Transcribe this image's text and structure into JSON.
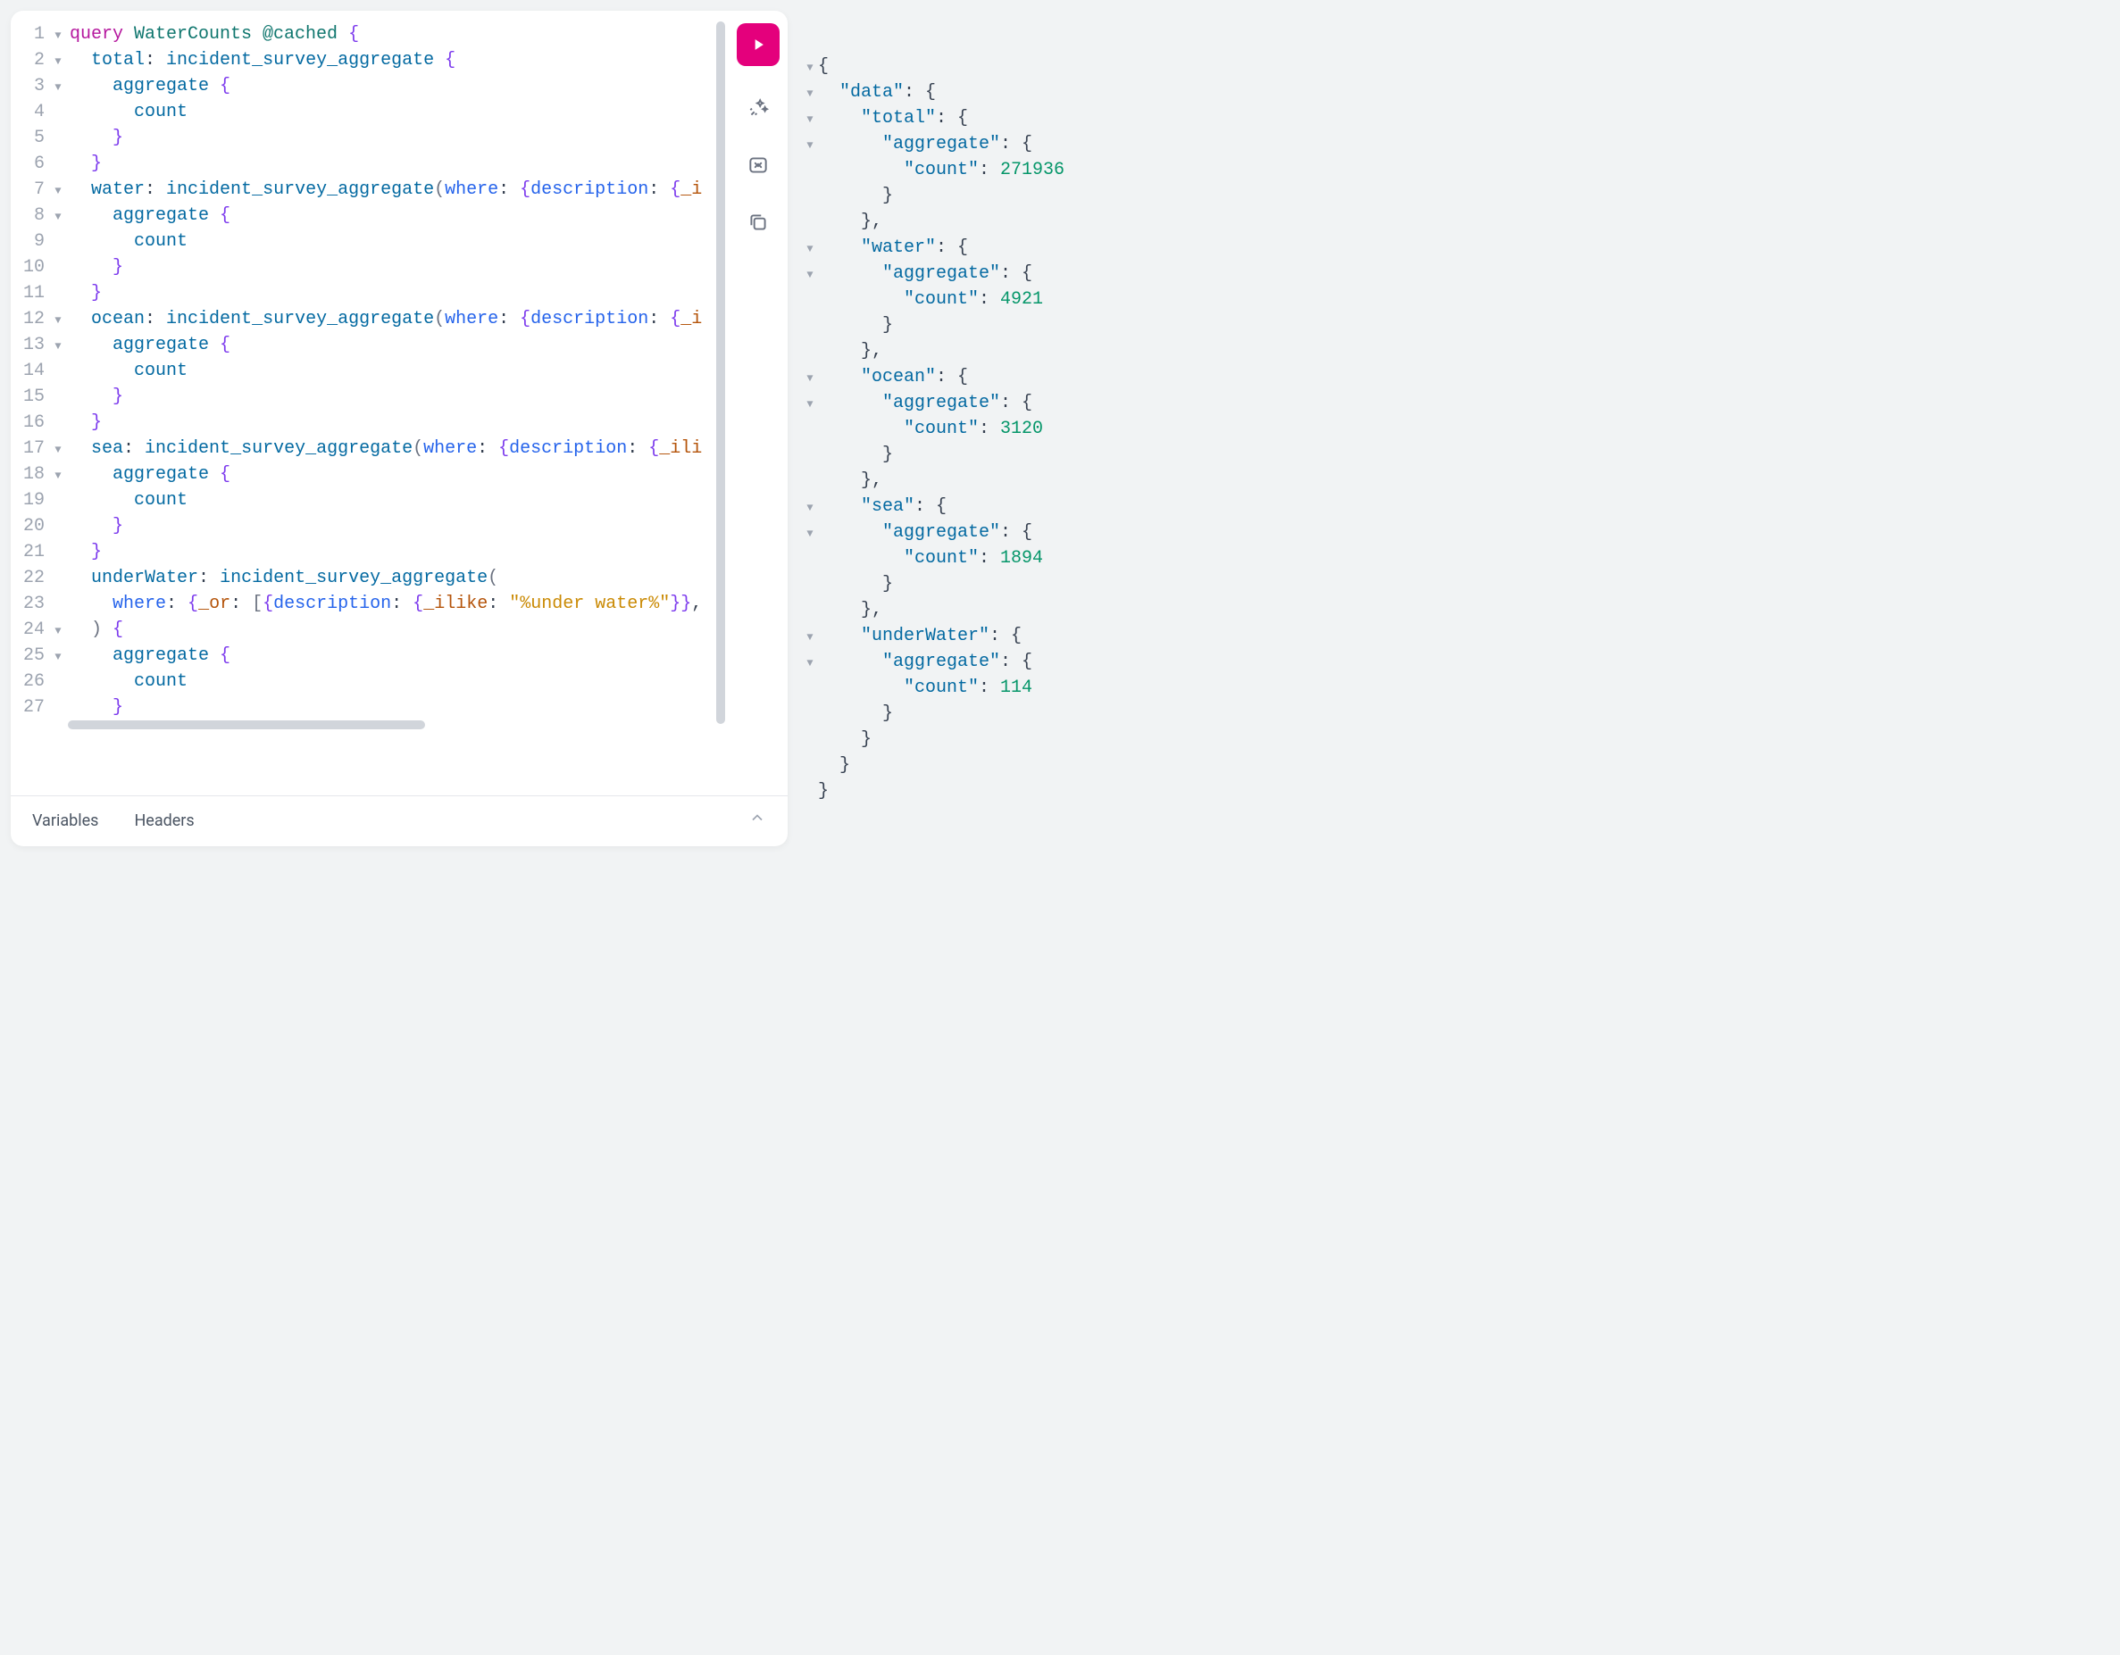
{
  "editor": {
    "lines": [
      {
        "n": 1,
        "fold": true,
        "tokens": [
          [
            "kw",
            "query "
          ],
          [
            "name",
            "WaterCounts "
          ],
          [
            "name",
            "@cached "
          ],
          [
            "brace",
            "{"
          ]
        ]
      },
      {
        "n": 2,
        "fold": true,
        "indent": 1,
        "tokens": [
          [
            "field",
            "total"
          ],
          [
            "plain",
            ": "
          ],
          [
            "field",
            "incident_survey_aggregate "
          ],
          [
            "brace",
            "{"
          ]
        ]
      },
      {
        "n": 3,
        "fold": true,
        "indent": 2,
        "tokens": [
          [
            "field",
            "aggregate "
          ],
          [
            "brace",
            "{"
          ]
        ]
      },
      {
        "n": 4,
        "fold": false,
        "indent": 3,
        "tokens": [
          [
            "field",
            "count"
          ]
        ]
      },
      {
        "n": 5,
        "fold": false,
        "indent": 2,
        "tokens": [
          [
            "brace",
            "}"
          ]
        ]
      },
      {
        "n": 6,
        "fold": false,
        "indent": 1,
        "tokens": [
          [
            "brace",
            "}"
          ]
        ]
      },
      {
        "n": 7,
        "fold": true,
        "indent": 1,
        "tokens": [
          [
            "field",
            "water"
          ],
          [
            "plain",
            ": "
          ],
          [
            "field",
            "incident_survey_aggregate"
          ],
          [
            "paren",
            "("
          ],
          [
            "arg",
            "where"
          ],
          [
            "plain",
            ": "
          ],
          [
            "brace",
            "{"
          ],
          [
            "arg",
            "description"
          ],
          [
            "plain",
            ": "
          ],
          [
            "brace",
            "{"
          ],
          [
            "und",
            "_i"
          ]
        ]
      },
      {
        "n": 8,
        "fold": true,
        "indent": 2,
        "tokens": [
          [
            "field",
            "aggregate "
          ],
          [
            "brace",
            "{"
          ]
        ]
      },
      {
        "n": 9,
        "fold": false,
        "indent": 3,
        "tokens": [
          [
            "field",
            "count"
          ]
        ]
      },
      {
        "n": 10,
        "fold": false,
        "indent": 2,
        "tokens": [
          [
            "brace",
            "}"
          ]
        ]
      },
      {
        "n": 11,
        "fold": false,
        "indent": 1,
        "tokens": [
          [
            "brace",
            "}"
          ]
        ]
      },
      {
        "n": 12,
        "fold": true,
        "indent": 1,
        "tokens": [
          [
            "field",
            "ocean"
          ],
          [
            "plain",
            ": "
          ],
          [
            "field",
            "incident_survey_aggregate"
          ],
          [
            "paren",
            "("
          ],
          [
            "arg",
            "where"
          ],
          [
            "plain",
            ": "
          ],
          [
            "brace",
            "{"
          ],
          [
            "arg",
            "description"
          ],
          [
            "plain",
            ": "
          ],
          [
            "brace",
            "{"
          ],
          [
            "und",
            "_i"
          ]
        ]
      },
      {
        "n": 13,
        "fold": true,
        "indent": 2,
        "tokens": [
          [
            "field",
            "aggregate "
          ],
          [
            "brace",
            "{"
          ]
        ]
      },
      {
        "n": 14,
        "fold": false,
        "indent": 3,
        "tokens": [
          [
            "field",
            "count"
          ]
        ]
      },
      {
        "n": 15,
        "fold": false,
        "indent": 2,
        "tokens": [
          [
            "brace",
            "}"
          ]
        ]
      },
      {
        "n": 16,
        "fold": false,
        "indent": 1,
        "tokens": [
          [
            "brace",
            "}"
          ]
        ]
      },
      {
        "n": 17,
        "fold": true,
        "indent": 1,
        "tokens": [
          [
            "field",
            "sea"
          ],
          [
            "plain",
            ": "
          ],
          [
            "field",
            "incident_survey_aggregate"
          ],
          [
            "paren",
            "("
          ],
          [
            "arg",
            "where"
          ],
          [
            "plain",
            ": "
          ],
          [
            "brace",
            "{"
          ],
          [
            "arg",
            "description"
          ],
          [
            "plain",
            ": "
          ],
          [
            "brace",
            "{"
          ],
          [
            "und",
            "_ili"
          ]
        ]
      },
      {
        "n": 18,
        "fold": true,
        "indent": 2,
        "tokens": [
          [
            "field",
            "aggregate "
          ],
          [
            "brace",
            "{"
          ]
        ]
      },
      {
        "n": 19,
        "fold": false,
        "indent": 3,
        "tokens": [
          [
            "field",
            "count"
          ]
        ]
      },
      {
        "n": 20,
        "fold": false,
        "indent": 2,
        "tokens": [
          [
            "brace",
            "}"
          ]
        ]
      },
      {
        "n": 21,
        "fold": false,
        "indent": 1,
        "tokens": [
          [
            "brace",
            "}"
          ]
        ]
      },
      {
        "n": 22,
        "fold": false,
        "indent": 1,
        "tokens": [
          [
            "field",
            "underWater"
          ],
          [
            "plain",
            ": "
          ],
          [
            "field",
            "incident_survey_aggregate"
          ],
          [
            "paren",
            "("
          ]
        ]
      },
      {
        "n": 23,
        "fold": false,
        "indent": 2,
        "tokens": [
          [
            "arg",
            "where"
          ],
          [
            "plain",
            ": "
          ],
          [
            "brace",
            "{"
          ],
          [
            "und",
            "_or"
          ],
          [
            "plain",
            ": "
          ],
          [
            "paren",
            "["
          ],
          [
            "brace",
            "{"
          ],
          [
            "arg",
            "description"
          ],
          [
            "plain",
            ": "
          ],
          [
            "brace",
            "{"
          ],
          [
            "und",
            "_ilike"
          ],
          [
            "plain",
            ": "
          ],
          [
            "str",
            "\"%under water%\""
          ],
          [
            "brace",
            "}}"
          ],
          [
            "plain",
            ","
          ]
        ]
      },
      {
        "n": 24,
        "fold": true,
        "indent": 1,
        "tokens": [
          [
            "paren",
            ") "
          ],
          [
            "brace",
            "{"
          ]
        ]
      },
      {
        "n": 25,
        "fold": true,
        "indent": 2,
        "tokens": [
          [
            "field",
            "aggregate "
          ],
          [
            "brace",
            "{"
          ]
        ]
      },
      {
        "n": 26,
        "fold": false,
        "indent": 3,
        "tokens": [
          [
            "field",
            "count"
          ]
        ]
      },
      {
        "n": 27,
        "fold": false,
        "indent": 2,
        "tokens": [
          [
            "brace",
            "}"
          ]
        ]
      }
    ]
  },
  "result": {
    "lines": [
      {
        "fold": true,
        "indent": 0,
        "tokens": [
          [
            "jp",
            "{"
          ]
        ]
      },
      {
        "fold": true,
        "indent": 1,
        "tokens": [
          [
            "jk",
            "\"data\""
          ],
          [
            "jp",
            ": {"
          ]
        ]
      },
      {
        "fold": true,
        "indent": 2,
        "tokens": [
          [
            "jk",
            "\"total\""
          ],
          [
            "jp",
            ": {"
          ]
        ]
      },
      {
        "fold": true,
        "indent": 3,
        "tokens": [
          [
            "jk",
            "\"aggregate\""
          ],
          [
            "jp",
            ": {"
          ]
        ]
      },
      {
        "fold": false,
        "indent": 4,
        "tokens": [
          [
            "jk",
            "\"count\""
          ],
          [
            "jp",
            ": "
          ],
          [
            "jn",
            "271936"
          ]
        ]
      },
      {
        "fold": false,
        "indent": 3,
        "tokens": [
          [
            "jp",
            "}"
          ]
        ]
      },
      {
        "fold": false,
        "indent": 2,
        "tokens": [
          [
            "jp",
            "},"
          ]
        ]
      },
      {
        "fold": true,
        "indent": 2,
        "tokens": [
          [
            "jk",
            "\"water\""
          ],
          [
            "jp",
            ": {"
          ]
        ]
      },
      {
        "fold": true,
        "indent": 3,
        "tokens": [
          [
            "jk",
            "\"aggregate\""
          ],
          [
            "jp",
            ": {"
          ]
        ]
      },
      {
        "fold": false,
        "indent": 4,
        "tokens": [
          [
            "jk",
            "\"count\""
          ],
          [
            "jp",
            ": "
          ],
          [
            "jn",
            "4921"
          ]
        ]
      },
      {
        "fold": false,
        "indent": 3,
        "tokens": [
          [
            "jp",
            "}"
          ]
        ]
      },
      {
        "fold": false,
        "indent": 2,
        "tokens": [
          [
            "jp",
            "},"
          ]
        ]
      },
      {
        "fold": true,
        "indent": 2,
        "tokens": [
          [
            "jk",
            "\"ocean\""
          ],
          [
            "jp",
            ": {"
          ]
        ]
      },
      {
        "fold": true,
        "indent": 3,
        "tokens": [
          [
            "jk",
            "\"aggregate\""
          ],
          [
            "jp",
            ": {"
          ]
        ]
      },
      {
        "fold": false,
        "indent": 4,
        "tokens": [
          [
            "jk",
            "\"count\""
          ],
          [
            "jp",
            ": "
          ],
          [
            "jn",
            "3120"
          ]
        ]
      },
      {
        "fold": false,
        "indent": 3,
        "tokens": [
          [
            "jp",
            "}"
          ]
        ]
      },
      {
        "fold": false,
        "indent": 2,
        "tokens": [
          [
            "jp",
            "},"
          ]
        ]
      },
      {
        "fold": true,
        "indent": 2,
        "tokens": [
          [
            "jk",
            "\"sea\""
          ],
          [
            "jp",
            ": {"
          ]
        ]
      },
      {
        "fold": true,
        "indent": 3,
        "tokens": [
          [
            "jk",
            "\"aggregate\""
          ],
          [
            "jp",
            ": {"
          ]
        ]
      },
      {
        "fold": false,
        "indent": 4,
        "tokens": [
          [
            "jk",
            "\"count\""
          ],
          [
            "jp",
            ": "
          ],
          [
            "jn",
            "1894"
          ]
        ]
      },
      {
        "fold": false,
        "indent": 3,
        "tokens": [
          [
            "jp",
            "}"
          ]
        ]
      },
      {
        "fold": false,
        "indent": 2,
        "tokens": [
          [
            "jp",
            "},"
          ]
        ]
      },
      {
        "fold": true,
        "indent": 2,
        "tokens": [
          [
            "jk",
            "\"underWater\""
          ],
          [
            "jp",
            ": {"
          ]
        ]
      },
      {
        "fold": true,
        "indent": 3,
        "tokens": [
          [
            "jk",
            "\"aggregate\""
          ],
          [
            "jp",
            ": {"
          ]
        ]
      },
      {
        "fold": false,
        "indent": 4,
        "tokens": [
          [
            "jk",
            "\"count\""
          ],
          [
            "jp",
            ": "
          ],
          [
            "jn",
            "114"
          ]
        ]
      },
      {
        "fold": false,
        "indent": 3,
        "tokens": [
          [
            "jp",
            "}"
          ]
        ]
      },
      {
        "fold": false,
        "indent": 2,
        "tokens": [
          [
            "jp",
            "}"
          ]
        ]
      },
      {
        "fold": false,
        "indent": 1,
        "tokens": [
          [
            "jp",
            "}"
          ]
        ]
      },
      {
        "fold": false,
        "indent": 0,
        "tokens": [
          [
            "jp",
            "}"
          ]
        ]
      }
    ]
  },
  "tabs": {
    "variables": "Variables",
    "headers": "Headers"
  },
  "icons": {
    "play": "play-icon",
    "prettify": "magic-wand-icon",
    "merge": "merge-fragments-icon",
    "copy": "copy-icon",
    "expand": "chevron-up-icon"
  }
}
